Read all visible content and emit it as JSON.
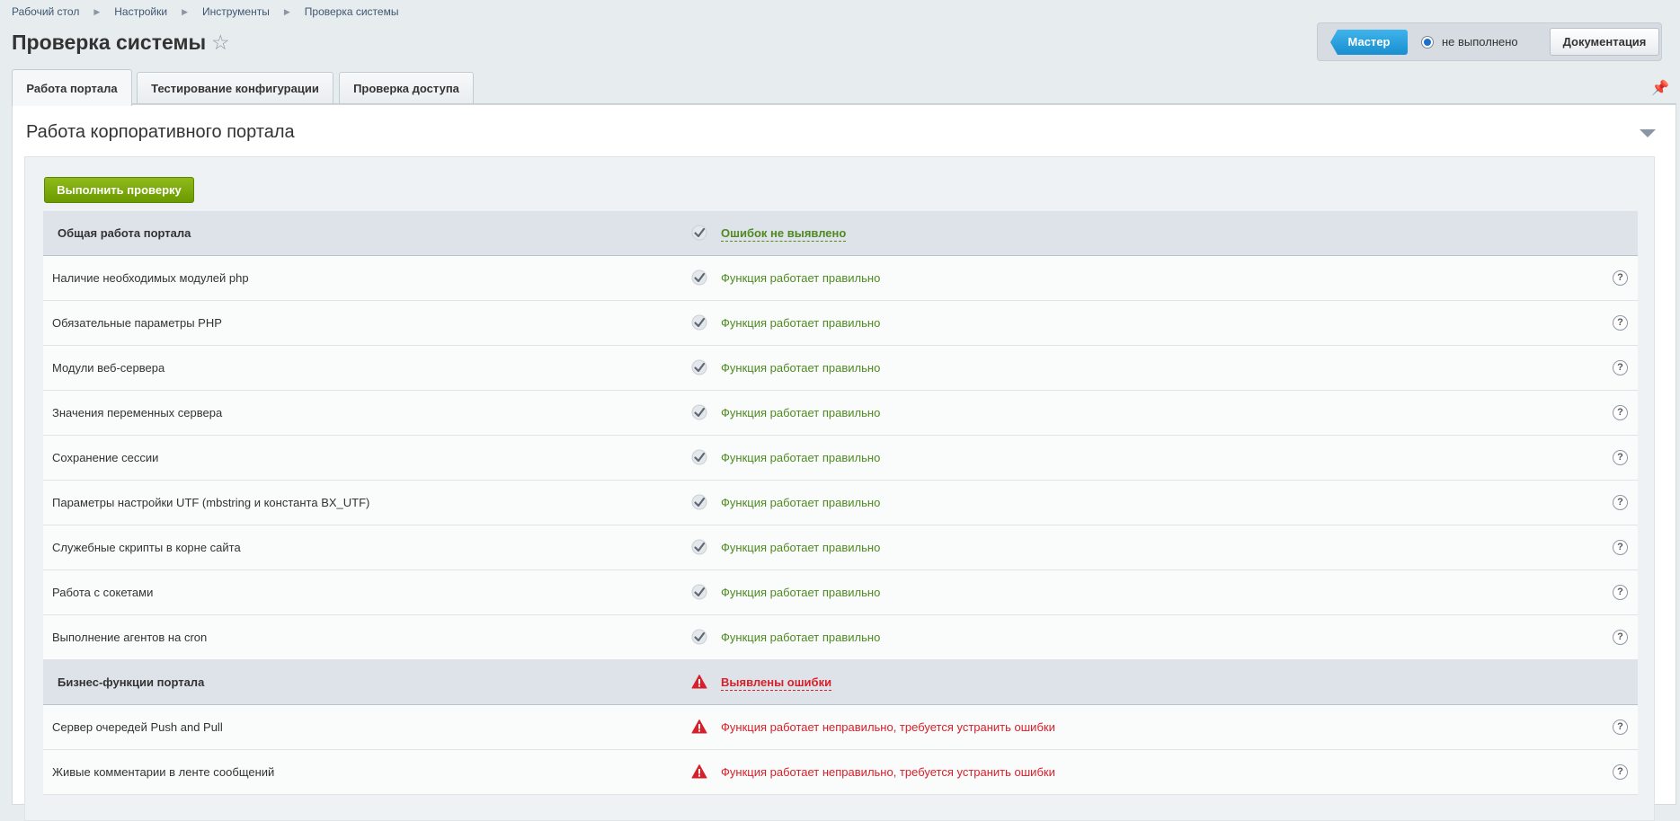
{
  "breadcrumb": [
    "Рабочий стол",
    "Настройки",
    "Инструменты",
    "Проверка системы"
  ],
  "page_title": "Проверка системы",
  "header": {
    "master_label": "Мастер",
    "status_text": "не выполнено",
    "docs_label": "Документация"
  },
  "tabs": [
    {
      "label": "Работа портала"
    },
    {
      "label": "Тестирование конфигурации"
    },
    {
      "label": "Проверка доступа"
    }
  ],
  "section_title": "Работа корпоративного портала",
  "run_button": "Выполнить проверку",
  "help_symbol": "?",
  "colors": {
    "ok": "#4e8a20",
    "error": "#d8202a",
    "accent": "#1a8fd0",
    "run": "#7aa80b"
  },
  "rows": [
    {
      "name": "Общая работа портала",
      "status": "Ошибок не выявлено",
      "kind": "group",
      "state": "ok"
    },
    {
      "name": "Наличие необходимых модулей php",
      "status": "Функция работает правильно",
      "kind": "item",
      "state": "ok"
    },
    {
      "name": "Обязательные параметры PHP",
      "status": "Функция работает правильно",
      "kind": "item",
      "state": "ok"
    },
    {
      "name": "Модули веб-сервера",
      "status": "Функция работает правильно",
      "kind": "item",
      "state": "ok"
    },
    {
      "name": "Значения переменных сервера",
      "status": "Функция работает правильно",
      "kind": "item",
      "state": "ok"
    },
    {
      "name": "Сохранение сессии",
      "status": "Функция работает правильно",
      "kind": "item",
      "state": "ok"
    },
    {
      "name": "Параметры настройки UTF (mbstring и константа BX_UTF)",
      "status": "Функция работает правильно",
      "kind": "item",
      "state": "ok"
    },
    {
      "name": "Служебные скрипты в корне сайта",
      "status": "Функция работает правильно",
      "kind": "item",
      "state": "ok"
    },
    {
      "name": "Работа с сокетами",
      "status": "Функция работает правильно",
      "kind": "item",
      "state": "ok"
    },
    {
      "name": "Выполнение агентов на cron",
      "status": "Функция работает правильно",
      "kind": "item",
      "state": "ok"
    },
    {
      "name": "Бизнес-функции портала",
      "status": "Выявлены ошибки",
      "kind": "group",
      "state": "error"
    },
    {
      "name": "Сервер очередей Push and Pull",
      "status": "Функция работает неправильно, требуется устранить ошибки",
      "kind": "item",
      "state": "error"
    },
    {
      "name": "Живые комментарии в ленте сообщений",
      "status": "Функция работает неправильно, требуется устранить ошибки",
      "kind": "item",
      "state": "error"
    }
  ]
}
